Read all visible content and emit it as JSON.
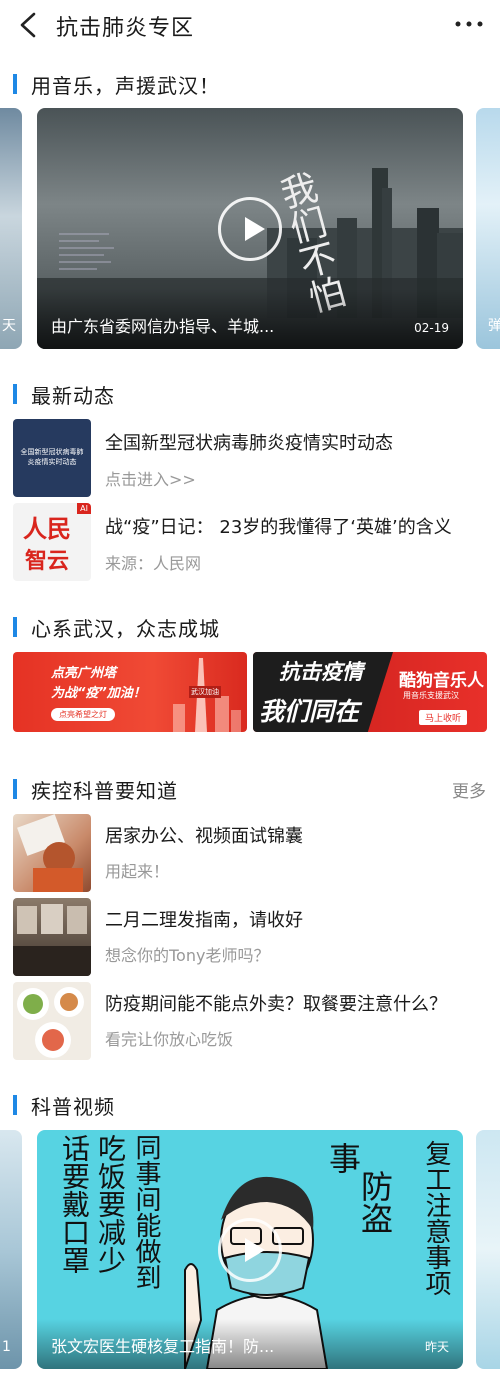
{
  "header": {
    "title": "抗击肺炎专区",
    "back_icon": "back-arrow-icon",
    "menu_icon": "more-dots-icon"
  },
  "music_section": {
    "title": "用音乐，声援武汉！",
    "left_peek_text": "天",
    "right_peek_text": "弹",
    "video": {
      "caption": "由广东省委网信办指导、羊城...",
      "date": "02-19",
      "overlay_text": "我们不怕"
    }
  },
  "news_section": {
    "title": "最新动态",
    "items": [
      {
        "title": "全国新型冠状病毒肺炎疫情实时动态",
        "subtitle": "点击进入>>",
        "thumb_text": "全国新型冠状病毒肺炎疫情实时动态"
      },
      {
        "title": "战“疫”日记： 23岁的我懂得了‘英雄’的含义",
        "subtitle": "来源：人民网",
        "thumb_logo": "人民",
        "thumb_logo2": "智云",
        "thumb_badge": "AI"
      }
    ]
  },
  "wuhan_section": {
    "title": "心系武汉，众志成城",
    "banners": [
      {
        "line1": "点亮广州塔",
        "line2": "为战“疫”加油！",
        "button": "点亮希望之灯",
        "tag": "武汉加油"
      },
      {
        "line1": "抗击疫情",
        "line2": "我们同在",
        "brand": "酷狗音乐人",
        "brand_sub": "用音乐支援武汉",
        "button": "马上收听"
      }
    ]
  },
  "knowledge_section": {
    "title": "疾控科普要知道",
    "more_label": "更多",
    "items": [
      {
        "title": "居家办公、视频面试锦囊",
        "subtitle": "用起来！"
      },
      {
        "title": "二月二理发指南，请收好",
        "subtitle": "想念你的Tony老师吗？"
      },
      {
        "title": "防疫期间能不能点外卖？取餐要注意什么？",
        "subtitle": "看完让你放心吃饭"
      }
    ]
  },
  "video_section": {
    "title": "科普视频",
    "left_peek_text": "1",
    "video": {
      "caption": "张文宏医生硬核复工指南！防...",
      "date": "昨天",
      "calligraphy_left": [
        "话要戴口罩",
        "吃饭要减少",
        "同事间能做到"
      ],
      "calligraphy_right": [
        "事",
        "防盗",
        "复工注意事项"
      ]
    }
  },
  "colors": {
    "accent": "#1e88e5",
    "red": "#e8302a"
  }
}
